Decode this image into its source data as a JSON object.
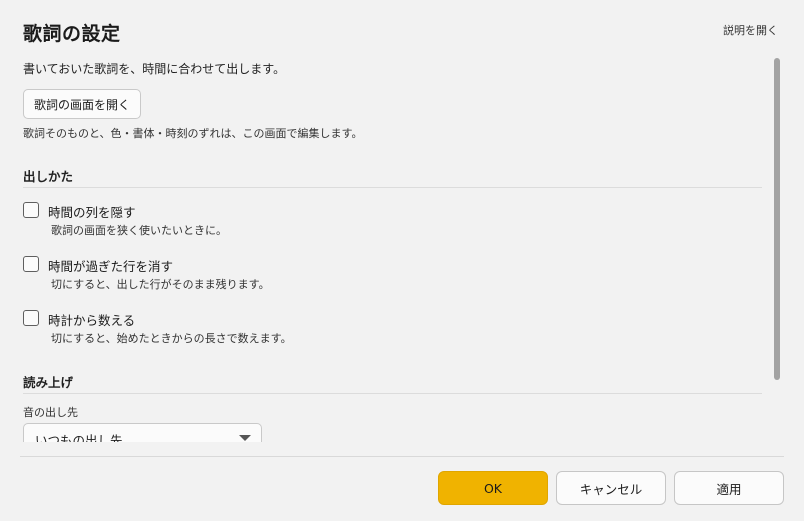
{
  "dialog": {
    "title": "歌詞の設定",
    "help_link": "説明を開く"
  },
  "lyrics": {
    "intro": "書いておいた歌詞を、時間に合わせて出します。",
    "open_button": "歌詞の画面を開く",
    "open_desc": "歌詞そのものと、色・書体・時刻のずれは、この画面で編集します。"
  },
  "display_section": {
    "heading": "出しかた",
    "options": [
      {
        "label": "時間の列を隠す",
        "desc": "歌詞の画面を狭く使いたいときに。",
        "checked": false
      },
      {
        "label": "時間が過ぎた行を消す",
        "desc": "切にすると、出した行がそのまま残ります。",
        "checked": false
      },
      {
        "label": "時計から数える",
        "desc": "切にすると、始めたときからの長さで数えます。",
        "checked": false
      }
    ]
  },
  "reading_section": {
    "heading": "読み上げ",
    "output_label": "音の出し先",
    "output_value": "いつもの出し先"
  },
  "footer": {
    "ok": "OK",
    "cancel": "キャンセル",
    "apply": "適用"
  },
  "colors": {
    "accent": "#f0b300",
    "background": "#f2f2f2"
  }
}
